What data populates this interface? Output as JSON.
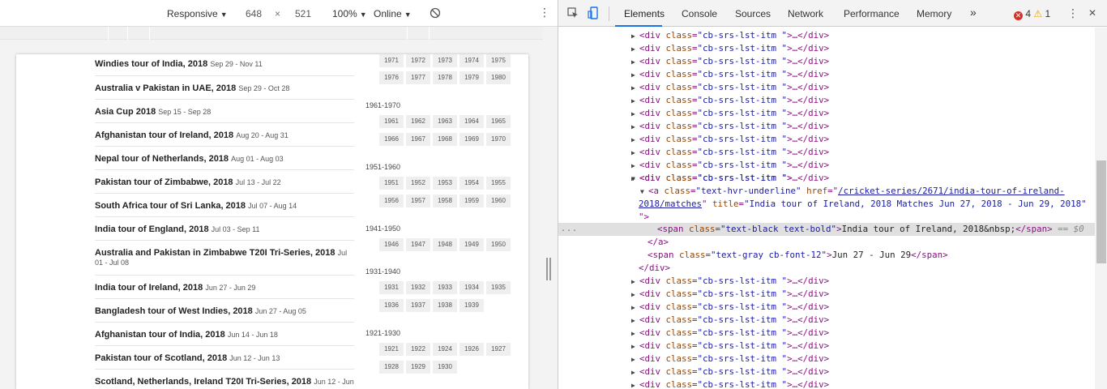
{
  "device_toolbar": {
    "mode_label": "Responsive",
    "width_value": "648",
    "times_sign": "×",
    "height_value": "521",
    "zoom_label": "100%",
    "network_label": "Online"
  },
  "series": [
    {
      "title": "Windies tour of India, 2018",
      "date": "Sep 29 - Nov 11"
    },
    {
      "title": "Australia v Pakistan in UAE, 2018",
      "date": "Sep 29 - Oct 28"
    },
    {
      "title": "Asia Cup 2018",
      "date": "Sep 15 - Sep 28"
    },
    {
      "title": "Afghanistan tour of Ireland, 2018",
      "date": "Aug 20 - Aug 31"
    },
    {
      "title": "Nepal tour of Netherlands, 2018",
      "date": "Aug 01 - Aug 03"
    },
    {
      "title": "Pakistan tour of Zimbabwe, 2018",
      "date": "Jul 13 - Jul 22"
    },
    {
      "title": "South Africa tour of Sri Lanka, 2018",
      "date": "Jul 07 - Aug 14"
    },
    {
      "title": "India tour of England, 2018",
      "date": "Jul 03 - Sep 11"
    },
    {
      "title": "Australia and Pakistan in Zimbabwe T20I Tri-Series, 2018",
      "date": "Jul 01 - Jul 08"
    },
    {
      "title": "India tour of Ireland, 2018",
      "date": "Jun 27 - Jun 29"
    },
    {
      "title": "Bangladesh tour of West Indies, 2018",
      "date": "Jun 27 - Aug 05"
    },
    {
      "title": "Afghanistan tour of India, 2018",
      "date": "Jun 14 - Jun 18"
    },
    {
      "title": "Pakistan tour of Scotland, 2018",
      "date": "Jun 12 - Jun 13"
    },
    {
      "title": "Scotland, Netherlands, Ireland T20I Tri-Series, 2018",
      "date": "Jun 12 - Jun"
    }
  ],
  "decades": [
    {
      "label": "",
      "rows": [
        [
          "1971",
          "1972",
          "1973",
          "1974",
          "1975"
        ],
        [
          "1976",
          "1977",
          "1978",
          "1979",
          "1980"
        ]
      ]
    },
    {
      "label": "1961-1970",
      "rows": [
        [
          "1961",
          "1962",
          "1963",
          "1964",
          "1965"
        ],
        [
          "1966",
          "1967",
          "1968",
          "1969",
          "1970"
        ]
      ]
    },
    {
      "label": "1951-1960",
      "rows": [
        [
          "1951",
          "1952",
          "1953",
          "1954",
          "1955"
        ],
        [
          "1956",
          "1957",
          "1958",
          "1959",
          "1960"
        ]
      ]
    },
    {
      "label": "1941-1950",
      "rows": [
        [
          "1946",
          "1947",
          "1948",
          "1949",
          "1950"
        ]
      ]
    },
    {
      "label": "1931-1940",
      "rows": [
        [
          "1931",
          "1932",
          "1933",
          "1934",
          "1935"
        ],
        [
          "1936",
          "1937",
          "1938",
          "1939"
        ]
      ]
    },
    {
      "label": "1921-1930",
      "rows": [
        [
          "1921",
          "1922",
          "1924",
          "1926",
          "1927"
        ],
        [
          "1928",
          "1929",
          "1930"
        ]
      ]
    }
  ],
  "devtools": {
    "tabs": [
      "Elements",
      "Console",
      "Sources",
      "Network",
      "Performance",
      "Memory"
    ],
    "more_tabs": "»",
    "error_count": "4",
    "warning_count": "1",
    "menu_dots": "⋮",
    "close_icon": "✕"
  },
  "dom": {
    "item_class": "\"cb-srs-lst-itm \"",
    "collapsed_tail": ">…</div>",
    "open_tail": ">",
    "anchor_class": "\"text-hvr-underline\"",
    "anchor_href": "/cricket-series/2671/india-tour-of-ireland-2018/matches",
    "anchor_title": "\"India tour of Ireland, 2018 Matches Jun 27, 2018 - Jun 29, 2018\"",
    "anchor_close_bracket": "\">",
    "selected_span_class": "\"text-black text-bold\"",
    "selected_span_text": "India tour of Ireland, 2018&nbsp;",
    "selected_marker": "== $0",
    "anchor_close": "</a>",
    "gray_span_class": "\"text-gray cb-font-12\"",
    "gray_span_text": "Jun 27 - Jun 29",
    "div_close": "</div>",
    "ellipsis": "..."
  }
}
